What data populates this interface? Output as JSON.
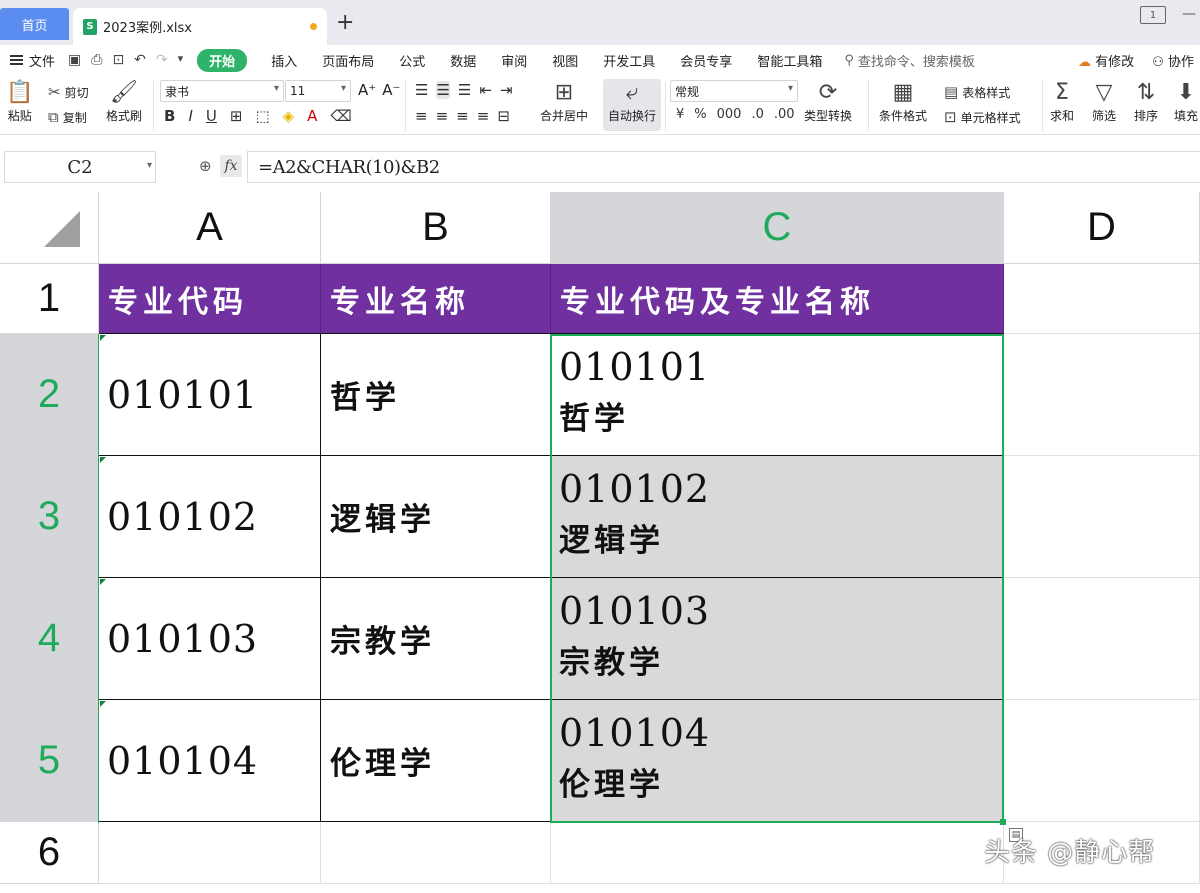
{
  "tabs": {
    "home": "首页",
    "file": "2023案例.xlsx",
    "file_icon": "S"
  },
  "window_ctrl": [
    "1",
    "—",
    "☐"
  ],
  "menu": {
    "file": "文件",
    "items": [
      "开始",
      "插入",
      "页面布局",
      "公式",
      "数据",
      "审阅",
      "视图",
      "开发工具",
      "会员专享",
      "智能工具箱"
    ],
    "search": "查找命令、搜索模板",
    "right": [
      "有修改",
      "协作"
    ]
  },
  "ribbon": {
    "paste": "粘贴",
    "cut": "剪切",
    "copy": "复制",
    "format_painter": "格式刷",
    "font_name": "隶书",
    "font_size": "11",
    "merge_center": "合并居中",
    "wrap_text": "自动换行",
    "number_format": "常规",
    "type_convert": "类型转换",
    "cond_format": "条件格式",
    "table_style": "表格样式",
    "cell_style": "单元格样式",
    "sum": "求和",
    "filter": "筛选",
    "sort": "排序",
    "fill": "填充"
  },
  "formula_bar": {
    "name_box": "C2",
    "formula": "=A2&CHAR(10)&B2",
    "fx": "fx"
  },
  "columns": [
    "A",
    "B",
    "C",
    "D"
  ],
  "rows": [
    "1",
    "2",
    "3",
    "4",
    "5",
    "6"
  ],
  "table": {
    "headers": [
      "专业代码",
      "专业名称",
      "专业代码及专业名称"
    ],
    "data": [
      {
        "code": "010101",
        "name": "哲学"
      },
      {
        "code": "010102",
        "name": "逻辑学"
      },
      {
        "code": "010103",
        "name": "宗教学"
      },
      {
        "code": "010104",
        "name": "伦理学"
      }
    ]
  },
  "watermark": "头条 @静心帮",
  "colors": {
    "header_fill": "#7030a0",
    "selection": "#1faa5c",
    "shade": "#d9d9d9",
    "start_tab": "#2fb36a"
  }
}
